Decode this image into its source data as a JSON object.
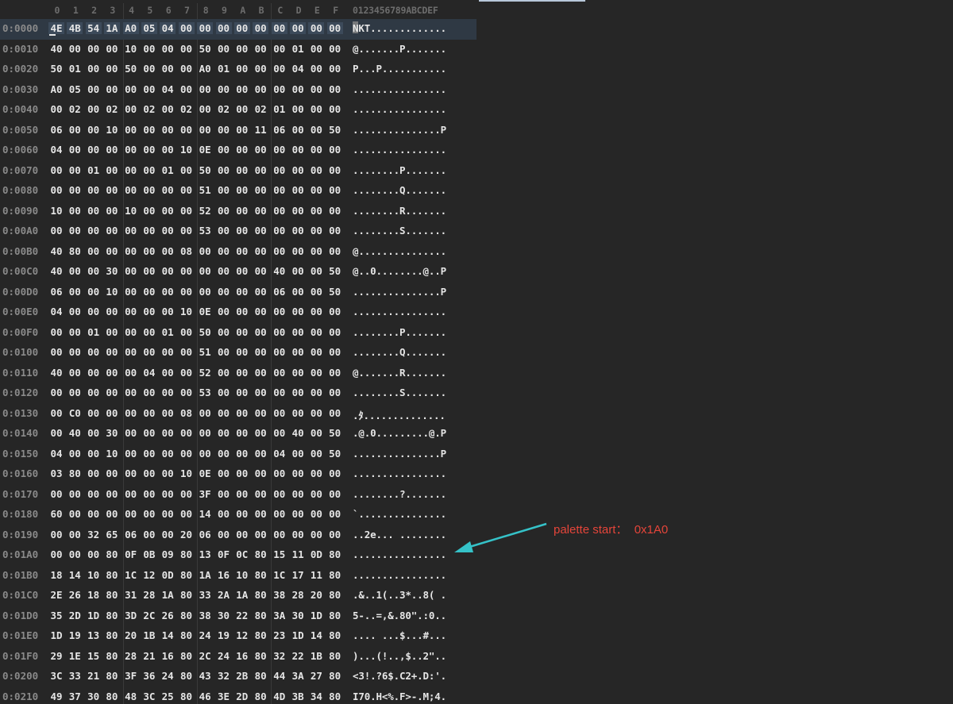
{
  "header": {
    "columns": [
      "0",
      "1",
      "2",
      "3",
      "4",
      "5",
      "6",
      "7",
      "8",
      "9",
      "A",
      "B",
      "C",
      "D",
      "E",
      "F"
    ],
    "ascii_header": "0123456789ABCDEF"
  },
  "rows": [
    {
      "addr": "0:0000",
      "bytes": [
        "4E",
        "4B",
        "54",
        "1A",
        "A0",
        "05",
        "04",
        "00",
        "00",
        "00",
        "00",
        "00",
        "00",
        "00",
        "00",
        "00"
      ],
      "ascii": "NKT............."
    },
    {
      "addr": "0:0010",
      "bytes": [
        "40",
        "00",
        "00",
        "00",
        "10",
        "00",
        "00",
        "00",
        "50",
        "00",
        "00",
        "00",
        "00",
        "01",
        "00",
        "00"
      ],
      "ascii": "@.......P......."
    },
    {
      "addr": "0:0020",
      "bytes": [
        "50",
        "01",
        "00",
        "00",
        "50",
        "00",
        "00",
        "00",
        "A0",
        "01",
        "00",
        "00",
        "00",
        "04",
        "00",
        "00"
      ],
      "ascii": "P...P..........."
    },
    {
      "addr": "0:0030",
      "bytes": [
        "A0",
        "05",
        "00",
        "00",
        "00",
        "00",
        "04",
        "00",
        "00",
        "00",
        "00",
        "00",
        "00",
        "00",
        "00",
        "00"
      ],
      "ascii": "................"
    },
    {
      "addr": "0:0040",
      "bytes": [
        "00",
        "02",
        "00",
        "02",
        "00",
        "02",
        "00",
        "02",
        "00",
        "02",
        "00",
        "02",
        "01",
        "00",
        "00",
        "00"
      ],
      "ascii": "................"
    },
    {
      "addr": "0:0050",
      "bytes": [
        "06",
        "00",
        "00",
        "10",
        "00",
        "00",
        "00",
        "00",
        "00",
        "00",
        "00",
        "11",
        "06",
        "00",
        "00",
        "50"
      ],
      "ascii": "...............P"
    },
    {
      "addr": "0:0060",
      "bytes": [
        "04",
        "00",
        "00",
        "00",
        "00",
        "00",
        "00",
        "10",
        "0E",
        "00",
        "00",
        "00",
        "00",
        "00",
        "00",
        "00"
      ],
      "ascii": "................"
    },
    {
      "addr": "0:0070",
      "bytes": [
        "00",
        "00",
        "01",
        "00",
        "00",
        "00",
        "01",
        "00",
        "50",
        "00",
        "00",
        "00",
        "00",
        "00",
        "00",
        "00"
      ],
      "ascii": "........P......."
    },
    {
      "addr": "0:0080",
      "bytes": [
        "00",
        "00",
        "00",
        "00",
        "00",
        "00",
        "00",
        "00",
        "51",
        "00",
        "00",
        "00",
        "00",
        "00",
        "00",
        "00"
      ],
      "ascii": "........Q......."
    },
    {
      "addr": "0:0090",
      "bytes": [
        "10",
        "00",
        "00",
        "00",
        "10",
        "00",
        "00",
        "00",
        "52",
        "00",
        "00",
        "00",
        "00",
        "00",
        "00",
        "00"
      ],
      "ascii": "........R......."
    },
    {
      "addr": "0:00A0",
      "bytes": [
        "00",
        "00",
        "00",
        "00",
        "00",
        "00",
        "00",
        "00",
        "53",
        "00",
        "00",
        "00",
        "00",
        "00",
        "00",
        "00"
      ],
      "ascii": "........S......."
    },
    {
      "addr": "0:00B0",
      "bytes": [
        "40",
        "80",
        "00",
        "00",
        "00",
        "00",
        "00",
        "08",
        "00",
        "00",
        "00",
        "00",
        "00",
        "00",
        "00",
        "00"
      ],
      "ascii": "@..............."
    },
    {
      "addr": "0:00C0",
      "bytes": [
        "40",
        "00",
        "00",
        "30",
        "00",
        "00",
        "00",
        "00",
        "00",
        "00",
        "00",
        "00",
        "40",
        "00",
        "00",
        "50"
      ],
      "ascii": "@..0........@..P"
    },
    {
      "addr": "0:00D0",
      "bytes": [
        "06",
        "00",
        "00",
        "10",
        "00",
        "00",
        "00",
        "00",
        "00",
        "00",
        "00",
        "00",
        "06",
        "00",
        "00",
        "50"
      ],
      "ascii": "...............P"
    },
    {
      "addr": "0:00E0",
      "bytes": [
        "04",
        "00",
        "00",
        "00",
        "00",
        "00",
        "00",
        "10",
        "0E",
        "00",
        "00",
        "00",
        "00",
        "00",
        "00",
        "00"
      ],
      "ascii": "................"
    },
    {
      "addr": "0:00F0",
      "bytes": [
        "00",
        "00",
        "01",
        "00",
        "00",
        "00",
        "01",
        "00",
        "50",
        "00",
        "00",
        "00",
        "00",
        "00",
        "00",
        "00"
      ],
      "ascii": "........P......."
    },
    {
      "addr": "0:0100",
      "bytes": [
        "00",
        "00",
        "00",
        "00",
        "00",
        "00",
        "00",
        "00",
        "51",
        "00",
        "00",
        "00",
        "00",
        "00",
        "00",
        "00"
      ],
      "ascii": "........Q......."
    },
    {
      "addr": "0:0110",
      "bytes": [
        "40",
        "00",
        "00",
        "00",
        "00",
        "04",
        "00",
        "00",
        "52",
        "00",
        "00",
        "00",
        "00",
        "00",
        "00",
        "00"
      ],
      "ascii": "@.......R......."
    },
    {
      "addr": "0:0120",
      "bytes": [
        "00",
        "00",
        "00",
        "00",
        "00",
        "00",
        "00",
        "00",
        "53",
        "00",
        "00",
        "00",
        "00",
        "00",
        "00",
        "00"
      ],
      "ascii": "........S......."
    },
    {
      "addr": "0:0130",
      "bytes": [
        "00",
        "C0",
        "00",
        "00",
        "00",
        "00",
        "00",
        "08",
        "00",
        "00",
        "00",
        "00",
        "00",
        "00",
        "00",
        "00"
      ],
      "ascii": ".ﾀ.............."
    },
    {
      "addr": "0:0140",
      "bytes": [
        "00",
        "40",
        "00",
        "30",
        "00",
        "00",
        "00",
        "00",
        "00",
        "00",
        "00",
        "00",
        "00",
        "40",
        "00",
        "50"
      ],
      "ascii": ".@.0.........@.P"
    },
    {
      "addr": "0:0150",
      "bytes": [
        "04",
        "00",
        "00",
        "10",
        "00",
        "00",
        "00",
        "00",
        "00",
        "00",
        "00",
        "00",
        "04",
        "00",
        "00",
        "50"
      ],
      "ascii": "...............P"
    },
    {
      "addr": "0:0160",
      "bytes": [
        "03",
        "80",
        "00",
        "00",
        "00",
        "00",
        "00",
        "10",
        "0E",
        "00",
        "00",
        "00",
        "00",
        "00",
        "00",
        "00"
      ],
      "ascii": "................"
    },
    {
      "addr": "0:0170",
      "bytes": [
        "00",
        "00",
        "00",
        "00",
        "00",
        "00",
        "00",
        "00",
        "3F",
        "00",
        "00",
        "00",
        "00",
        "00",
        "00",
        "00"
      ],
      "ascii": "........?......."
    },
    {
      "addr": "0:0180",
      "bytes": [
        "60",
        "00",
        "00",
        "00",
        "00",
        "00",
        "00",
        "00",
        "14",
        "00",
        "00",
        "00",
        "00",
        "00",
        "00",
        "00"
      ],
      "ascii": "`..............."
    },
    {
      "addr": "0:0190",
      "bytes": [
        "00",
        "00",
        "32",
        "65",
        "06",
        "00",
        "00",
        "20",
        "06",
        "00",
        "00",
        "00",
        "00",
        "00",
        "00",
        "00"
      ],
      "ascii": "..2e... ........"
    },
    {
      "addr": "0:01A0",
      "bytes": [
        "00",
        "00",
        "00",
        "80",
        "0F",
        "0B",
        "09",
        "80",
        "13",
        "0F",
        "0C",
        "80",
        "15",
        "11",
        "0D",
        "80"
      ],
      "ascii": "................"
    },
    {
      "addr": "0:01B0",
      "bytes": [
        "18",
        "14",
        "10",
        "80",
        "1C",
        "12",
        "0D",
        "80",
        "1A",
        "16",
        "10",
        "80",
        "1C",
        "17",
        "11",
        "80"
      ],
      "ascii": "................"
    },
    {
      "addr": "0:01C0",
      "bytes": [
        "2E",
        "26",
        "18",
        "80",
        "31",
        "28",
        "1A",
        "80",
        "33",
        "2A",
        "1A",
        "80",
        "38",
        "28",
        "20",
        "80"
      ],
      "ascii": ".&..1(..3*..8( ."
    },
    {
      "addr": "0:01D0",
      "bytes": [
        "35",
        "2D",
        "1D",
        "80",
        "3D",
        "2C",
        "26",
        "80",
        "38",
        "30",
        "22",
        "80",
        "3A",
        "30",
        "1D",
        "80"
      ],
      "ascii": "5-..=,&.80\".:0.."
    },
    {
      "addr": "0:01E0",
      "bytes": [
        "1D",
        "19",
        "13",
        "80",
        "20",
        "1B",
        "14",
        "80",
        "24",
        "19",
        "12",
        "80",
        "23",
        "1D",
        "14",
        "80"
      ],
      "ascii": ".... ...$...#..."
    },
    {
      "addr": "0:01F0",
      "bytes": [
        "29",
        "1E",
        "15",
        "80",
        "28",
        "21",
        "16",
        "80",
        "2C",
        "24",
        "16",
        "80",
        "32",
        "22",
        "1B",
        "80"
      ],
      "ascii": ")...(!..,$..2\".."
    },
    {
      "addr": "0:0200",
      "bytes": [
        "3C",
        "33",
        "21",
        "80",
        "3F",
        "36",
        "24",
        "80",
        "43",
        "32",
        "2B",
        "80",
        "44",
        "3A",
        "27",
        "80"
      ],
      "ascii": "<3!.?6$.C2+.D:'."
    },
    {
      "addr": "0:0210",
      "bytes": [
        "49",
        "37",
        "30",
        "80",
        "48",
        "3C",
        "25",
        "80",
        "46",
        "3E",
        "2D",
        "80",
        "4D",
        "3B",
        "34",
        "80"
      ],
      "ascii": "I70.H<%.F>-.M;4."
    }
  ],
  "annotation": {
    "text": "palette start：  0x1A0",
    "color": "#e5453a",
    "arrow_color": "#35c2c8"
  },
  "colors": {
    "background": "#262626",
    "address": "#8a8a8a",
    "bytes": "#e6e6e6",
    "header": "#6d6d6d",
    "active_row": "#2f3944"
  }
}
